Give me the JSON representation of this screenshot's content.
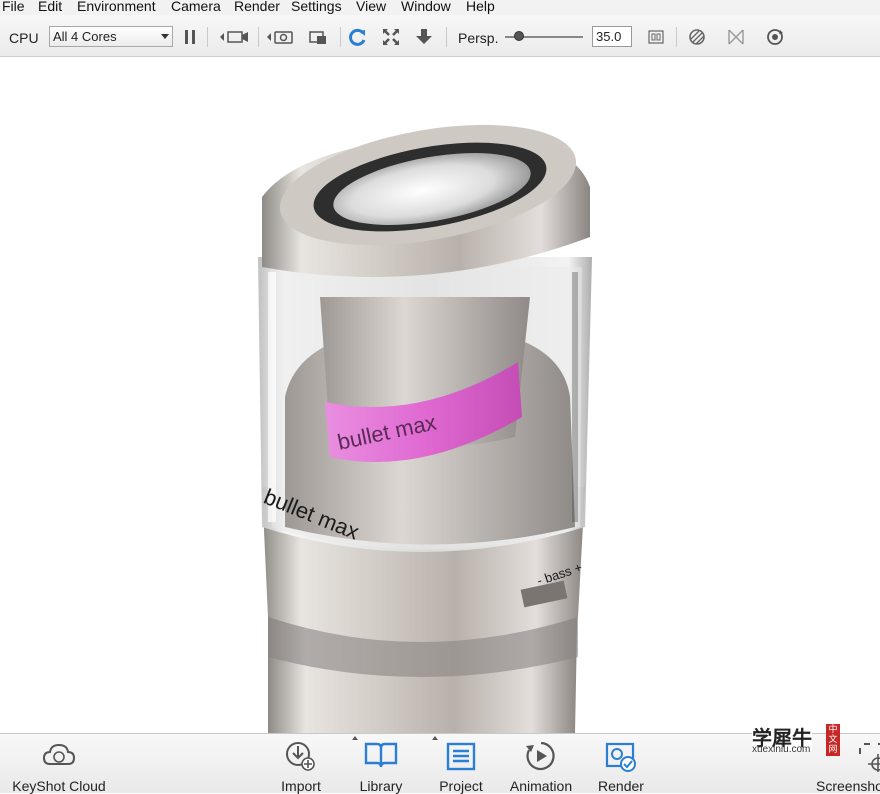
{
  "menu": [
    "File",
    "Edit",
    "Environment",
    "Camera",
    "Render",
    "Settings",
    "View",
    "Window",
    "Help"
  ],
  "toolbar": {
    "cpu_label": "CPU",
    "cores_value": "All 4 Cores",
    "persp_label": "Persp.",
    "persp_value": "35.0",
    "icons": [
      "pause-icon",
      "camera-back-icon",
      "screenshot-icon",
      "camera-add-icon",
      "refresh-icon",
      "fit-icon",
      "drop-to-floor-icon",
      "fov-slider",
      "region-icon",
      "material-icon",
      "geometry-icon",
      "tumble-icon"
    ]
  },
  "viewport": {
    "band_text": "bullet max",
    "body_text": "bullet max",
    "bass_label": "- bass +"
  },
  "dock": {
    "items": [
      {
        "label": "KeyShot Cloud",
        "icon": "cloud-icon"
      },
      {
        "label": "Import",
        "icon": "import-icon"
      },
      {
        "label": "Library",
        "icon": "book-icon"
      },
      {
        "label": "Project",
        "icon": "project-icon"
      },
      {
        "label": "Animation",
        "icon": "play-icon"
      },
      {
        "label": "Render",
        "icon": "render-icon"
      },
      {
        "label": "Screensho",
        "icon": "screenshot-crosshair-icon"
      }
    ]
  },
  "watermark": {
    "cn": "学犀牛",
    "site": "xuexiniu.com",
    "seal": "中文网"
  },
  "colors": {
    "accent": "#2a7fd4",
    "band": "#e06ad2"
  }
}
